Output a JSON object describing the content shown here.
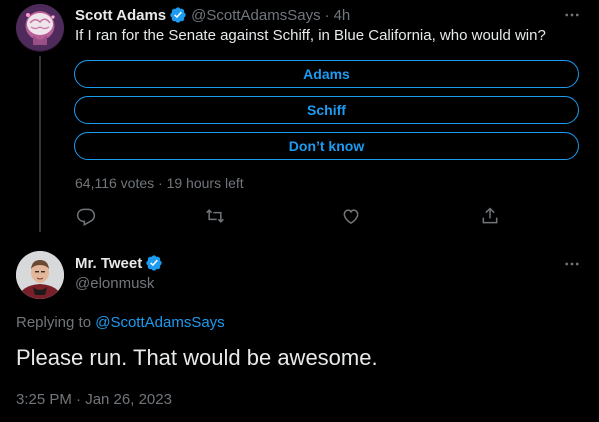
{
  "parent_tweet": {
    "author_name": "Scott Adams",
    "author_handle": "@ScottAdamsSays",
    "separator": "·",
    "age": "4h",
    "text": "If I ran for the Senate against Schiff, in Blue California, who would win?",
    "poll": {
      "options": [
        "Adams",
        "Schiff",
        "Don’t know"
      ],
      "votes": "64,116 votes",
      "meta_separator": "·",
      "time_left": "19 hours left"
    },
    "actions": [
      "reply-icon",
      "retweet-icon",
      "like-icon",
      "share-icon"
    ]
  },
  "reply_tweet": {
    "author_name": "Mr. Tweet",
    "author_handle": "@elonmusk",
    "replying_prefix": "Replying to",
    "replying_to": "@ScottAdamsSays",
    "text": "Please run. That would be awesome.",
    "timestamp": "3:25 PM · Jan 26, 2023"
  },
  "colors": {
    "background": "#000000",
    "accent": "#1d9bf0",
    "text_primary": "#e7e9ea",
    "text_secondary": "#71767b",
    "divider": "#333639"
  }
}
